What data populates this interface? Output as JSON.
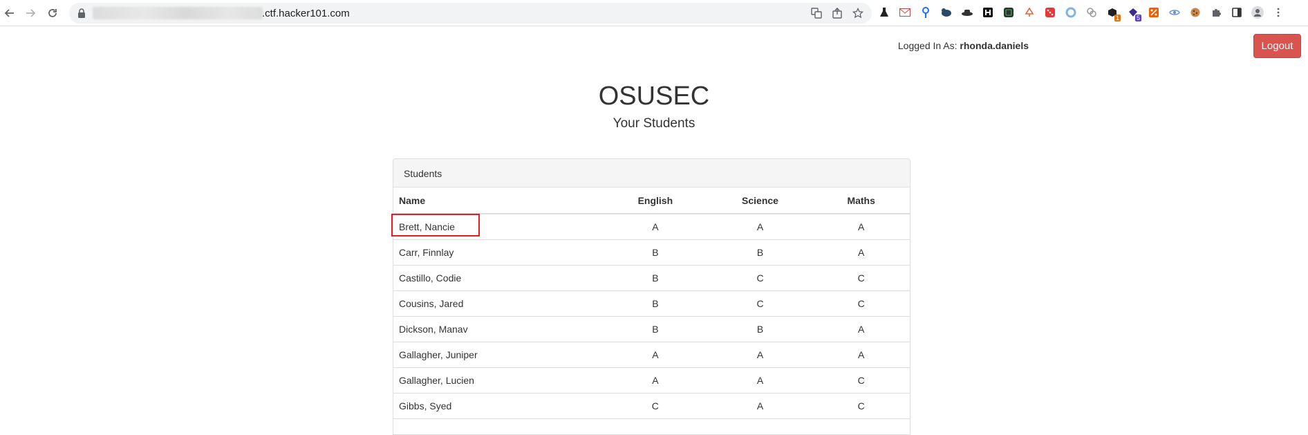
{
  "browser": {
    "url": ".ctf.hacker101.com"
  },
  "header": {
    "logged_in_label": "Logged In As:",
    "username": "rhonda.daniels",
    "logout_label": "Logout"
  },
  "main": {
    "title": "OSUSEC",
    "subtitle": "Your Students"
  },
  "panel": {
    "heading": "Students",
    "columns": [
      "Name",
      "English",
      "Science",
      "Maths"
    ],
    "rows": [
      {
        "name": "Brett, Nancie",
        "english": "A",
        "science": "A",
        "maths": "A"
      },
      {
        "name": "Carr, Finnlay",
        "english": "B",
        "science": "B",
        "maths": "A"
      },
      {
        "name": "Castillo, Codie",
        "english": "B",
        "science": "C",
        "maths": "C"
      },
      {
        "name": "Cousins, Jared",
        "english": "B",
        "science": "C",
        "maths": "C"
      },
      {
        "name": "Dickson, Manav",
        "english": "B",
        "science": "B",
        "maths": "A"
      },
      {
        "name": "Gallagher, Juniper",
        "english": "A",
        "science": "A",
        "maths": "A"
      },
      {
        "name": "Gallagher, Lucien",
        "english": "A",
        "science": "A",
        "maths": "C"
      },
      {
        "name": "Gibbs, Syed",
        "english": "C",
        "science": "A",
        "maths": "C"
      },
      {
        "name": "",
        "english": "",
        "science": "",
        "maths": ""
      }
    ]
  },
  "colors": {
    "logout_bg": "#d9534f",
    "highlight_border": "#e31f26"
  },
  "icons": {
    "omnibox": [
      "translate-icon",
      "share-icon",
      "star-icon"
    ],
    "extensions": [
      "flask-icon",
      "envelope-icon",
      "pin-icon",
      "bird-icon",
      "hat-icon",
      "h-icon",
      "terminal-icon",
      "tree-icon",
      "dice-icon",
      "ring-icon",
      "chain-icon",
      "box-icon",
      "gem-icon",
      "percent-icon",
      "eye-icon",
      "cookie-icon",
      "puzzle-icon",
      "sidepanel-icon",
      "profile-icon",
      "menu-icon"
    ],
    "extension_badges": {
      "box-icon": "1",
      "gem-icon": "5"
    }
  }
}
